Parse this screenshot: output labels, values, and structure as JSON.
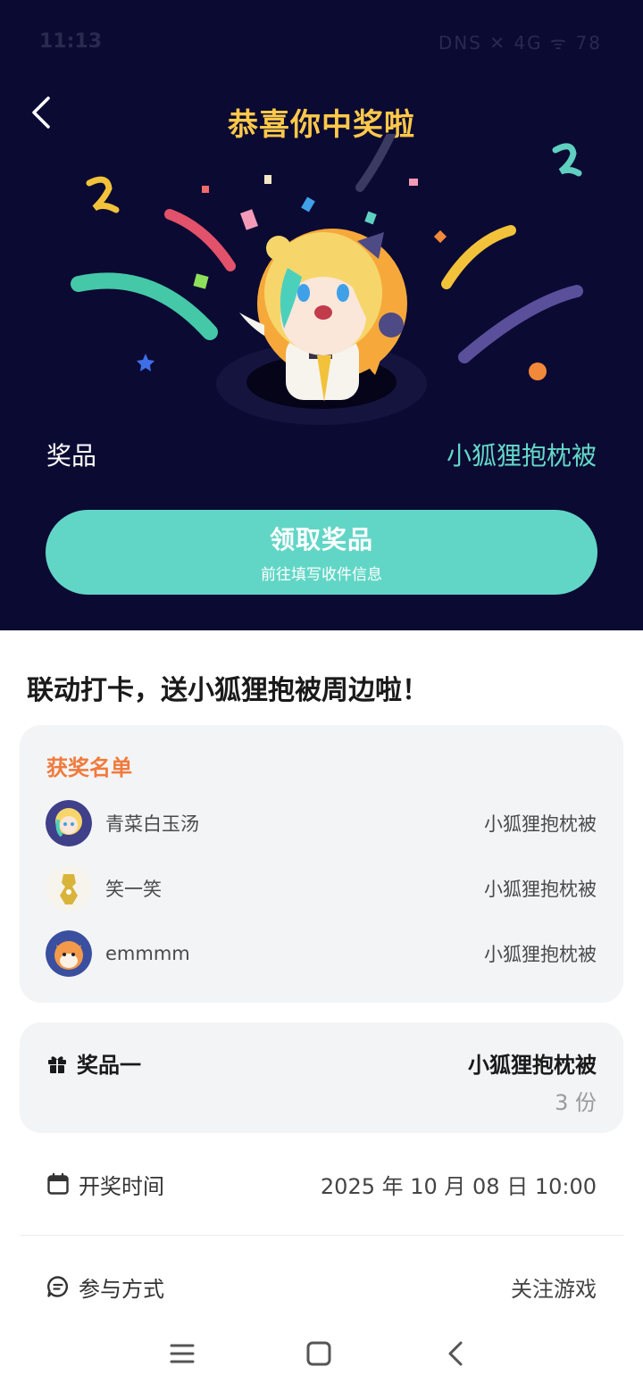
{
  "status": {
    "time": "11:13",
    "indicators": "DNS ✕ 4G ᯤ 78"
  },
  "hero": {
    "title": "恭喜你中奖啦",
    "prize_label": "奖品",
    "prize_value": "小狐狸抱枕被",
    "claim_button": {
      "label": "领取奖品",
      "sublabel": "前往填写收件信息"
    }
  },
  "event": {
    "title": "联动打卡，送小狐狸抱被周边啦！"
  },
  "winners": {
    "heading": "获奖名单",
    "items": [
      {
        "name": "青菜白玉汤",
        "prize": "小狐狸抱枕被"
      },
      {
        "name": "笑一笑",
        "prize": "小狐狸抱枕被"
      },
      {
        "name": "emmmm",
        "prize": "小狐狸抱枕被"
      }
    ]
  },
  "prize_card": {
    "label": "奖品一",
    "name": "小狐狸抱枕被",
    "count": "3 份"
  },
  "draw_time": {
    "label": "开奖时间",
    "value": "2025 年 10 月 08 日 10:00"
  },
  "participation": {
    "label": "参与方式",
    "value": "关注游戏"
  },
  "colors": {
    "hero_bg": "#0b0a33",
    "accent": "#62d6c6",
    "title_gold": "#ffc94a",
    "winners_heading": "#f07a3c"
  }
}
